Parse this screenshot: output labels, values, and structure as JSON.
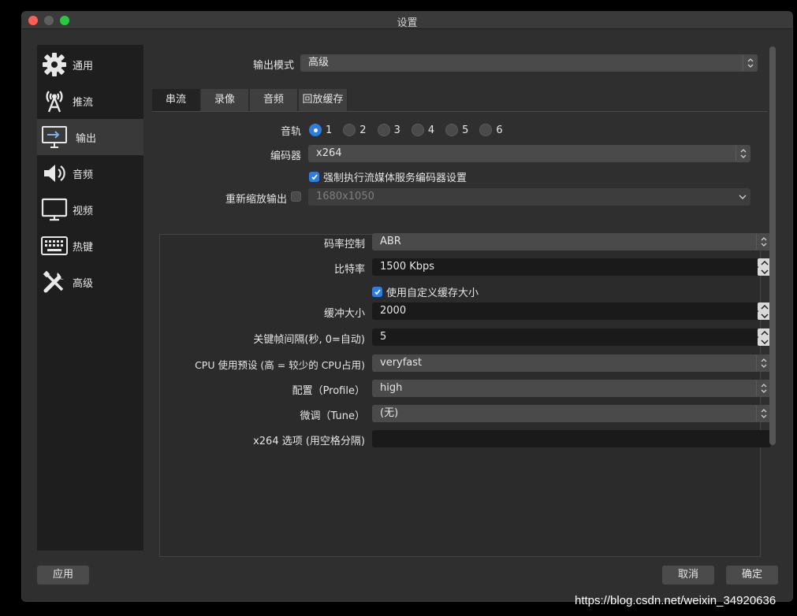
{
  "window": {
    "title": "设置"
  },
  "sidebar": {
    "items": [
      {
        "label": "通用",
        "icon": "gear-icon"
      },
      {
        "label": "推流",
        "icon": "antenna-icon"
      },
      {
        "label": "输出",
        "icon": "monitor-output-icon",
        "active": true
      },
      {
        "label": "音频",
        "icon": "speaker-icon"
      },
      {
        "label": "视频",
        "icon": "monitor-icon"
      },
      {
        "label": "热键",
        "icon": "keyboard-icon"
      },
      {
        "label": "高级",
        "icon": "tools-icon"
      }
    ]
  },
  "output_mode": {
    "label": "输出模式",
    "value": "高级"
  },
  "tabs": [
    "串流",
    "录像",
    "音频",
    "回放缓存"
  ],
  "active_tab": "串流",
  "audio_track": {
    "label": "音轨",
    "options": [
      "1",
      "2",
      "3",
      "4",
      "5",
      "6"
    ],
    "selected": "1"
  },
  "encoder": {
    "label": "编码器",
    "value": "x264"
  },
  "enforce_checkbox": {
    "label": "强制执行流媒体服务编码器设置",
    "checked": true
  },
  "rescale": {
    "label": "重新缩放输出",
    "checked": false,
    "value": "1680x1050"
  },
  "settings": {
    "rate_control": {
      "label": "码率控制",
      "value": "ABR"
    },
    "bitrate": {
      "label": "比特率",
      "value": "1500 Kbps"
    },
    "custom_buffer": {
      "label": "使用自定义缓存大小",
      "checked": true
    },
    "buffer_size": {
      "label": "缓冲大小",
      "value": "2000"
    },
    "keyframe": {
      "label": "关键帧间隔(秒, 0=自动)",
      "value": "5"
    },
    "cpu_preset": {
      "label": "CPU 使用预设 (高 = 较少的 CPU占用)",
      "value": "veryfast"
    },
    "profile": {
      "label": "配置（Profile）",
      "value": "high"
    },
    "tune": {
      "label": "微调（Tune）",
      "value": "(无)"
    },
    "x264_opts": {
      "label": "x264 选项 (用空格分隔)",
      "value": ""
    }
  },
  "buttons": {
    "apply": "应用",
    "cancel": "取消",
    "ok": "确定"
  },
  "watermark": "https://blog.csdn.net/weixin_34920636",
  "colors": {
    "accent": "#2e7de1",
    "window_bg": "#2f2f2f",
    "sidebar_bg": "#1e1e1e"
  }
}
